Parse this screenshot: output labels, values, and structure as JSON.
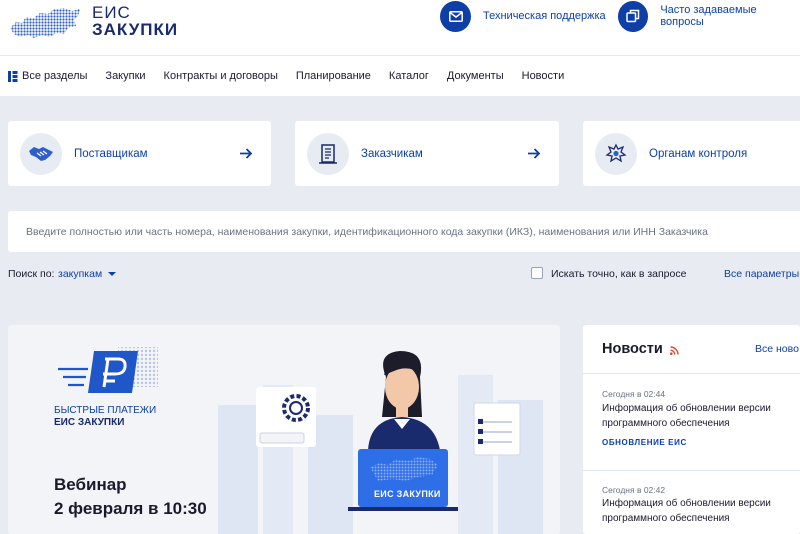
{
  "logo": {
    "line1": "ЕИС",
    "line2": "ЗАКУПКИ"
  },
  "header": {
    "support_label": "Техническая поддержка",
    "faq_label": "Часто задаваемые вопросы"
  },
  "nav": {
    "items": [
      {
        "label": "Все разделы"
      },
      {
        "label": "Закупки"
      },
      {
        "label": "Контракты и договоры"
      },
      {
        "label": "Планирование"
      },
      {
        "label": "Каталог"
      },
      {
        "label": "Документы"
      },
      {
        "label": "Новости"
      }
    ]
  },
  "cards": [
    {
      "label": "Поставщикам",
      "icon": "handshake-icon"
    },
    {
      "label": "Заказчикам",
      "icon": "document-building-icon"
    },
    {
      "label": "Органам контроля",
      "icon": "emblem-icon"
    }
  ],
  "search": {
    "placeholder": "Введите полностью или часть номера, наименования закупки, идентификационного кода закупки (ИКЗ), наименования или ИНН Заказчика"
  },
  "search_options": {
    "label": "Поиск по:",
    "selected": "закупкам",
    "exact_label": "Искать точно, как в запросе",
    "advanced_label": "Все параметры п"
  },
  "banner": {
    "title_line1": "БЫСТРЫЕ ПЛАТЕЖИ",
    "title_line2": "ЕИС ЗАКУПКИ",
    "laptop_text": "ЕИС ЗАКУПКИ",
    "webinar": "Вебинар",
    "date": "2 февраля в 10:30"
  },
  "news": {
    "title": "Новости",
    "all_label": "Все ново",
    "items": [
      {
        "time": "Сегодня в 02:44",
        "title": "Информация об обновлении версии программного обеспечения",
        "tag": "ОБНОВЛЕНИЕ ЕИС"
      },
      {
        "time": "Сегодня в 02:42",
        "title": "Информация об обновлении версии программного обеспечения"
      }
    ]
  },
  "colors": {
    "accent": "#0d3fa6",
    "background": "#e8ecf2",
    "rss": "#e2422a"
  }
}
